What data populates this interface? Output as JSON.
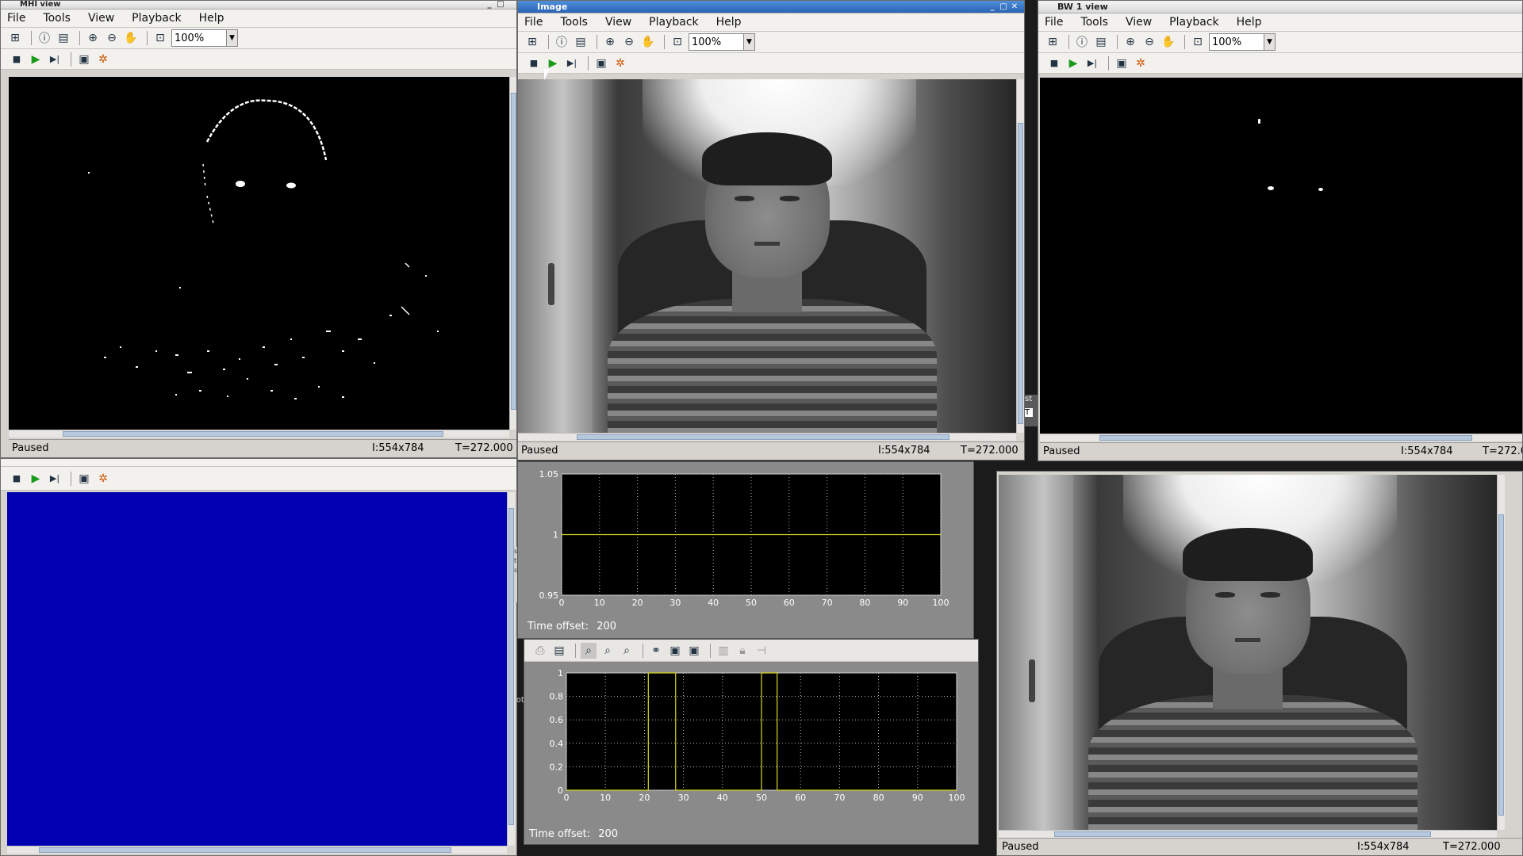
{
  "menus": [
    "File",
    "Tools",
    "View",
    "Playback",
    "Help"
  ],
  "zoom_value": "100%",
  "windows": {
    "mhi": {
      "title": "MHI view",
      "status": "Paused",
      "info": "I:554x784",
      "time": "T=272.000"
    },
    "image": {
      "title": "Image",
      "status": "Paused",
      "info": "I:554x784",
      "time": "T=272.000"
    },
    "bw": {
      "title": "BW 1 view",
      "status": "Paused",
      "info": "I:554x784",
      "time": "T=272.0"
    },
    "bottom_right": {
      "status": "Paused",
      "info": "I:554x784",
      "time": "T=272.000"
    }
  },
  "fragments": {
    "st": "st",
    "t_letter": "T",
    "sy": "sy",
    "ti": "ti",
    "s_": "s_",
    "lot": "lot"
  },
  "colors": {
    "blue_view": "#0000b0",
    "plot_bg": "#000000",
    "plot_line": "#d8d820",
    "window_bg": "#d6d3ce",
    "titlebar_active": "#2a63b5"
  },
  "chart_data": [
    {
      "type": "line",
      "x": [
        0,
        100
      ],
      "series": [
        {
          "values": [
            1,
            1
          ]
        }
      ],
      "xlim": [
        0,
        100
      ],
      "ylim": [
        0.95,
        1.05
      ],
      "xticks": [
        "0",
        "10",
        "20",
        "30",
        "40",
        "50",
        "60",
        "70",
        "80",
        "90",
        "100"
      ],
      "yticks": [
        "0.95",
        "1",
        "1.05"
      ],
      "grid": true,
      "offset_label": "Time offset:",
      "offset_value": "200"
    },
    {
      "type": "line",
      "pulses": [
        [
          21,
          28
        ],
        [
          50,
          54
        ]
      ],
      "xlim": [
        0,
        100
      ],
      "ylim": [
        0,
        1
      ],
      "xticks": [
        "0",
        "10",
        "20",
        "30",
        "40",
        "50",
        "60",
        "70",
        "80",
        "90",
        "100"
      ],
      "yticks": [
        "0",
        "0.2",
        "0.4",
        "0.6",
        "0.8",
        "1"
      ],
      "grid": true,
      "offset_label": "Time offset:",
      "offset_value": "200"
    }
  ]
}
